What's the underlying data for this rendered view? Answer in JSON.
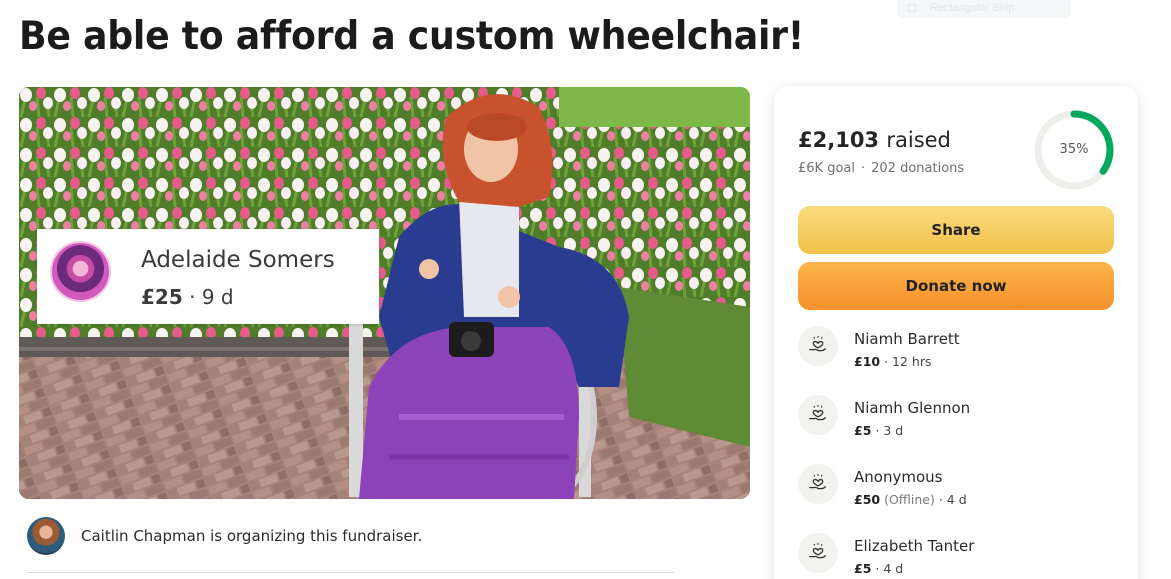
{
  "page": {
    "title": "Be able to afford a custom wheelchair!",
    "snip_hint": "Rectangular Snip"
  },
  "hero": {
    "latest_donation": {
      "name": "Adelaide Somers",
      "amount": "£25",
      "time": "9 d"
    }
  },
  "organizer": {
    "text": "Caitlin Chapman is organizing this fundraiser."
  },
  "progress": {
    "raised_amount": "£2,103",
    "raised_label": "raised",
    "goal": "£6K goal",
    "donations": "202 donations",
    "percent": 35,
    "percent_label": "35%",
    "color_track": "#eeeeea",
    "color_fill": "#02a95c"
  },
  "actions": {
    "share_label": "Share",
    "donate_label": "Donate now"
  },
  "donations": [
    {
      "name": "Niamh Barrett",
      "amount": "£10",
      "note": "",
      "time": "12 hrs"
    },
    {
      "name": "Niamh Glennon",
      "amount": "£5",
      "note": "",
      "time": "3 d"
    },
    {
      "name": "Anonymous",
      "amount": "£50",
      "note": "(Offline)",
      "time": "4 d"
    },
    {
      "name": "Elizabeth Tanter",
      "amount": "£5",
      "note": "",
      "time": "4 d"
    }
  ]
}
